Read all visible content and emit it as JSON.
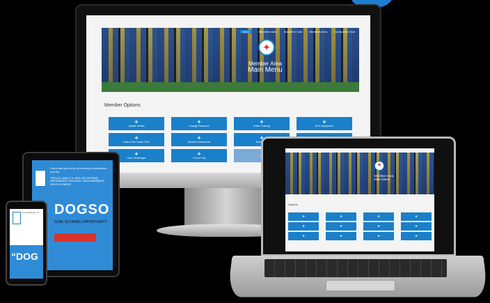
{
  "site": {
    "nav": [
      "Home",
      "Members Area",
      "About the Club",
      "Members Area",
      "Contact the Club"
    ],
    "hero_logo": "✦",
    "hero_title_line1": "Member Area",
    "hero_title_line2": "Main Menu",
    "options_heading": "Member Options",
    "tiles": [
      {
        "label": "Update Details",
        "faded": false
      },
      {
        "label": "Change Password",
        "faded": false
      },
      {
        "label": "Online Training",
        "faded": false
      },
      {
        "label": "Kit & Equipment",
        "faded": false
      },
      {
        "label": "Laws of the Game 2019",
        "faded": false
      },
      {
        "label": "Member Documents",
        "faded": false
      },
      {
        "label": "Newsletter",
        "faded": false
      },
      {
        "label": "Discussion Board",
        "faded": false
      },
      {
        "label": "Lane Challenges",
        "faded": false
      },
      {
        "label": "I Got of Pay",
        "faded": false
      },
      {
        "label": "",
        "faded": true
      },
      {
        "label": "",
        "faded": true
      }
    ],
    "tile_icon": "✚"
  },
  "tablet": {
    "intro_text": "Come and join us for an evening of interaction and fun...",
    "body_text": "THE N.A. AND F.A. AND DELIVERING DEFENDERS TRAINING, NEW MEMBERS DEVELOPMENT...",
    "headline": "DOGSO",
    "sub_text": "GOAL SCORING OPPORTUNITY"
  },
  "phone": {
    "intro_text": "Come and join us...",
    "headline": "“DOG"
  },
  "laptop": {
    "hero_title_line1": "Member Area",
    "hero_title_line2": "Main Menu",
    "options_heading": "Options",
    "tile_count": 12
  },
  "colors": {
    "brand_blue": "#1a80c9",
    "background": "#000000"
  }
}
